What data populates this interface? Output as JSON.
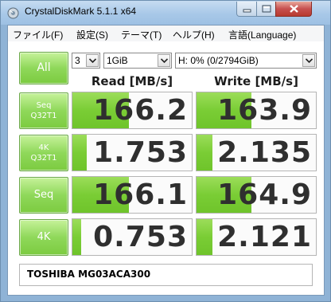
{
  "window": {
    "title": "CrystalDiskMark 5.1.1 x64",
    "icon": "crystaldiskmark-app-icon",
    "controls": [
      "minimize-icon",
      "maximize-icon",
      "close-icon"
    ]
  },
  "menu": {
    "file": "ファイル(F)",
    "settings": "設定(S)",
    "theme": "テーマ(T)",
    "help": "ヘルプ(H)",
    "language": "言語(Language)"
  },
  "controls": {
    "all_label": "All",
    "count": "3",
    "size": "1GiB",
    "drive": "H: 0% (0/2794GiB)"
  },
  "headers": {
    "read": "Read [MB/s]",
    "write": "Write [MB/s]"
  },
  "rows": [
    {
      "line1": "Seq",
      "line2": "Q32T1",
      "read": "166.2",
      "write": "163.9",
      "read_level": 0.47,
      "write_level": 0.46
    },
    {
      "line1": "4K",
      "line2": "Q32T1",
      "read": "1.753",
      "write": "2.135",
      "read_level": 0.12,
      "write_level": 0.13
    },
    {
      "line1": "Seq",
      "line2": "",
      "read": "166.1",
      "write": "164.9",
      "read_level": 0.47,
      "write_level": 0.46
    },
    {
      "line1": "4K",
      "line2": "",
      "read": "0.753",
      "write": "2.121",
      "read_level": 0.07,
      "write_level": 0.13
    }
  ],
  "comment": "TOSHIBA MG03ACA300",
  "colors": {
    "bar_green": "#7acd35",
    "button_green": "#8fd85a",
    "value_text": "#2f2f2f",
    "title_bar": "#a8c8e8",
    "close_button": "#c75050"
  }
}
